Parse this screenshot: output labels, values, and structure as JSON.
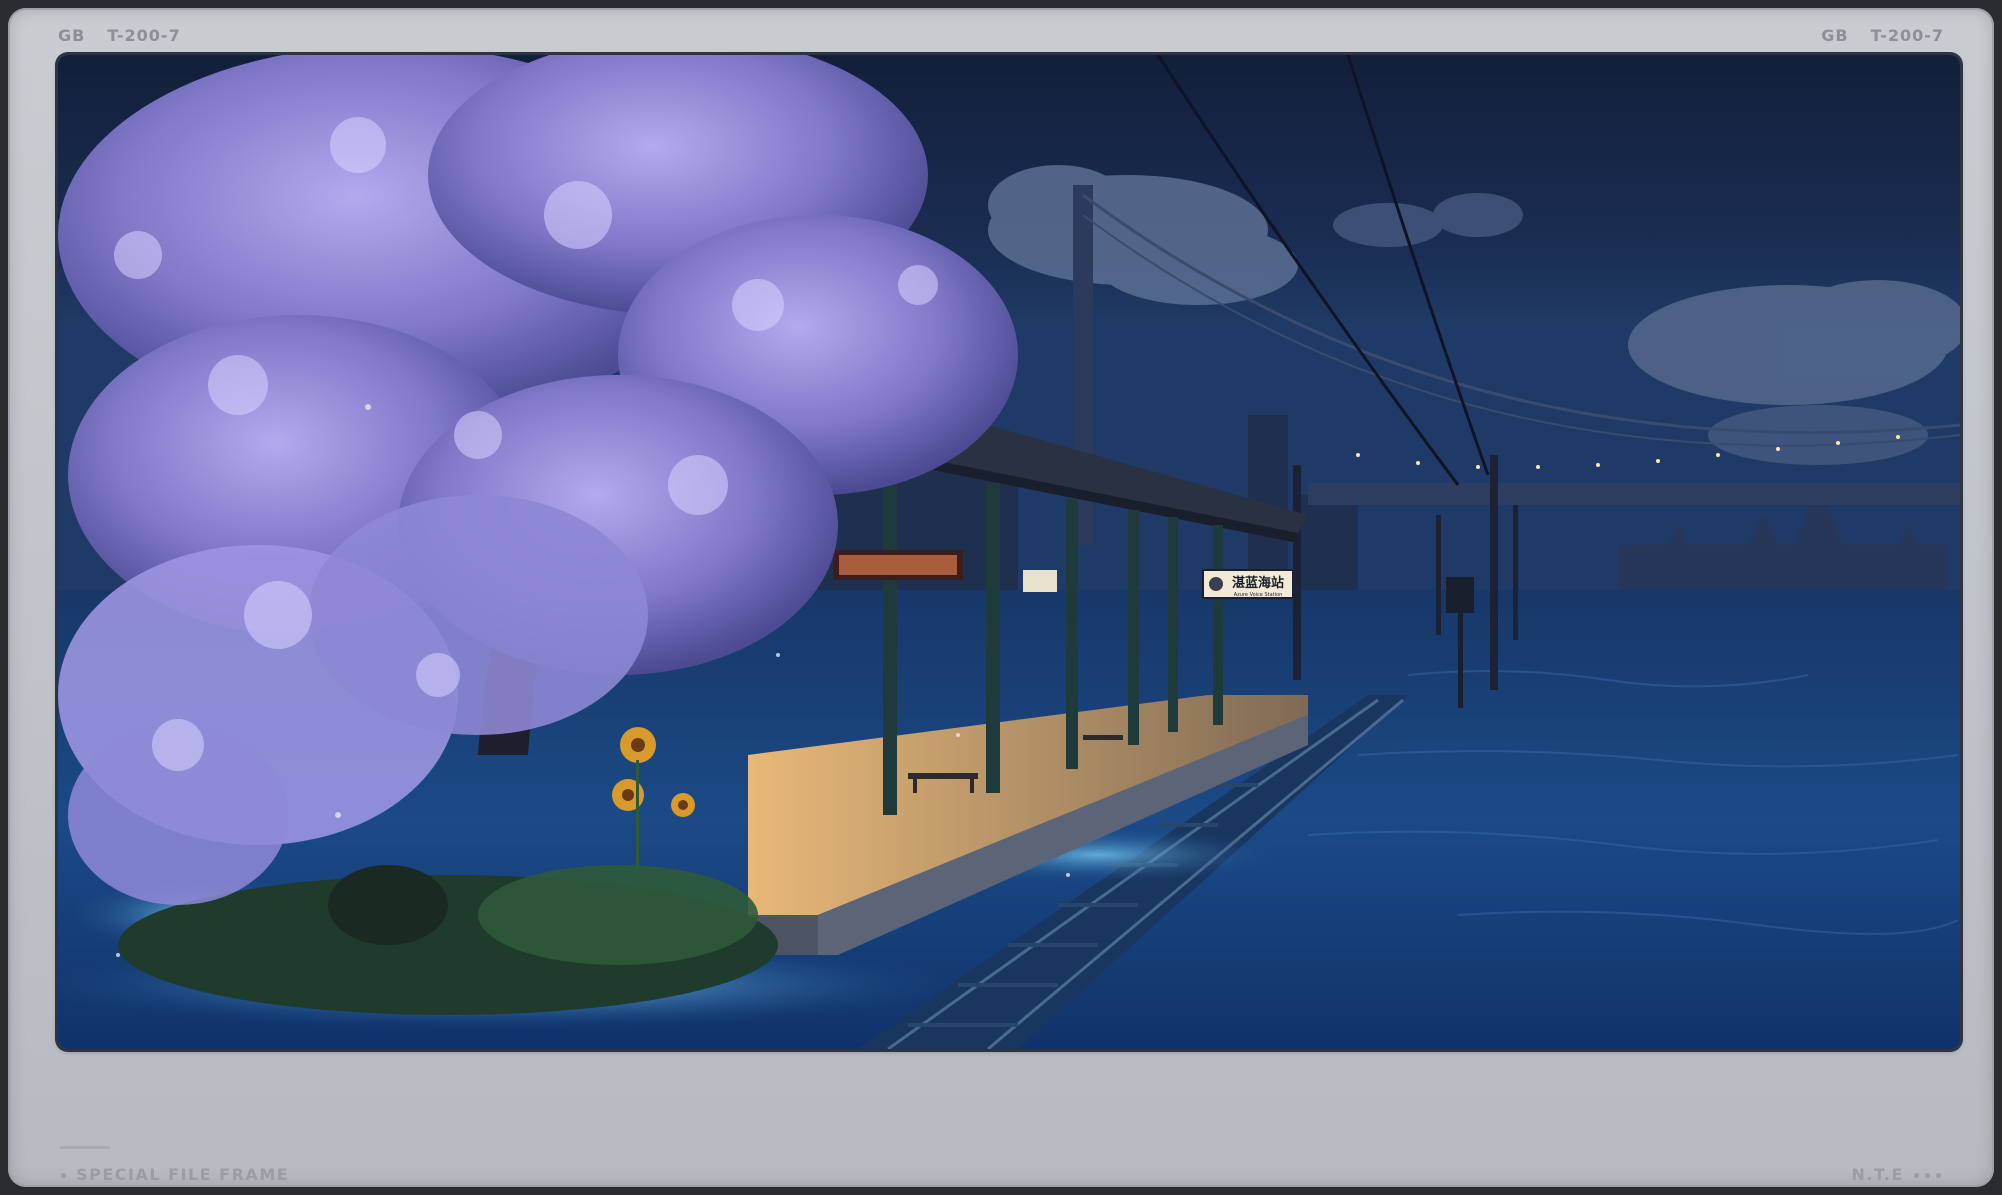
{
  "frame": {
    "top_left_code": "GB",
    "top_left_id": "T-200-7",
    "top_right_code": "GB",
    "top_right_id": "T-200-7",
    "footer_left_label": "SPECIAL FILE FRAME",
    "footer_right_label": "N.T.E"
  },
  "scene": {
    "station_sign_text": "湛蓝海站",
    "station_sign_subtext": "Azure Voice Station"
  },
  "colors": {
    "frame": "#c3c7cc",
    "sky": "#1c3358",
    "sea": "#1d4478",
    "blossom": "#8f86d6",
    "platform_light": "#e9b877"
  }
}
